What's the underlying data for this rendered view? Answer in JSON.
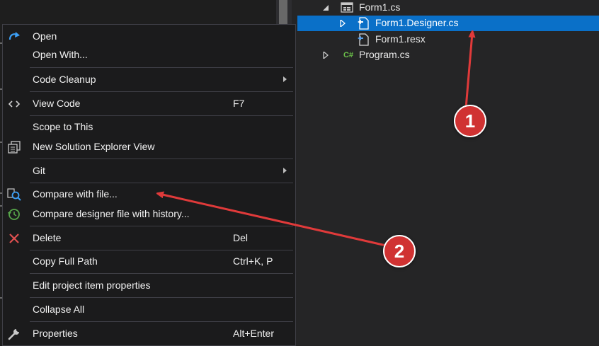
{
  "solution_explorer": {
    "items": [
      {
        "label": "Form1.cs",
        "expanded": true,
        "icon": "form-icon"
      },
      {
        "label": "Form1.Designer.cs",
        "selected": true,
        "icon": "csharp-file-icon"
      },
      {
        "label": "Form1.resx",
        "icon": "resource-file-icon"
      },
      {
        "label": "Program.cs",
        "icon": "csharp-icon"
      }
    ],
    "csharp_badge": "C#"
  },
  "context_menu": {
    "items": [
      {
        "label": "Open",
        "icon": "open-arrow-icon"
      },
      {
        "label": "Open With..."
      },
      {
        "label": "Code Cleanup",
        "submenu": true
      },
      {
        "label": "View Code",
        "shortcut": "F7",
        "icon": "code-icon"
      },
      {
        "label": "Scope to This"
      },
      {
        "label": "New Solution Explorer View",
        "icon": "new-view-icon"
      },
      {
        "label": "Git",
        "submenu": true
      },
      {
        "label": "Compare with file...",
        "icon": "compare-icon"
      },
      {
        "label": "Compare designer file with history...",
        "icon": "history-icon"
      },
      {
        "label": "Delete",
        "shortcut": "Del",
        "icon": "delete-icon"
      },
      {
        "label": "Copy Full Path",
        "shortcut": "Ctrl+K, P"
      },
      {
        "label": "Edit project item properties"
      },
      {
        "label": "Collapse All"
      },
      {
        "label": "Properties",
        "shortcut": "Alt+Enter",
        "icon": "wrench-icon"
      }
    ]
  },
  "annotations": [
    {
      "number": "1",
      "color": "#d03232"
    },
    {
      "number": "2",
      "color": "#d03232"
    }
  ],
  "colors": {
    "background": "#1e1e1e",
    "panel": "#252526",
    "menu_background": "#1b1b1c",
    "selection": "#0a70c8",
    "annotation_red": "#d03232"
  }
}
